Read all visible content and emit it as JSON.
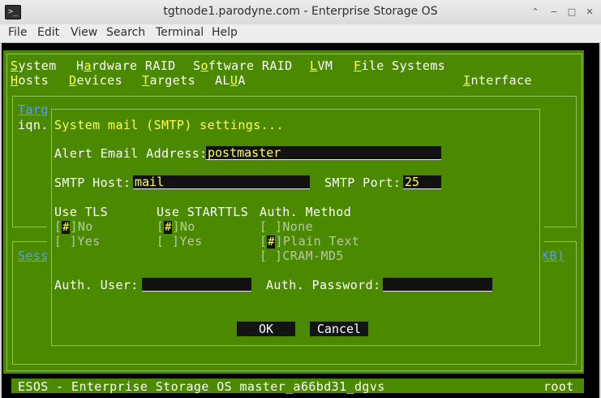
{
  "window": {
    "title": "tgtnode1.parodyne.com - Enterprise Storage OS",
    "controls": [
      "⌃",
      "−",
      "□",
      "✕"
    ]
  },
  "menubar": [
    "File",
    "Edit",
    "View",
    "Search",
    "Terminal",
    "Help"
  ],
  "tui_menu": {
    "row1": [
      {
        "key": "S",
        "rest": "ystem"
      },
      {
        "pre": "H",
        "key": "a",
        "rest": "rdware RAID"
      },
      {
        "pre": "S",
        "key": "o",
        "rest": "ftware RAID"
      },
      {
        "key": "L",
        "rest": "VM"
      },
      {
        "key": "F",
        "rest": "ile Systems"
      }
    ],
    "row2": [
      {
        "key": "H",
        "rest": "osts"
      },
      {
        "key": "D",
        "rest": "evices"
      },
      {
        "key": "T",
        "rest": "argets"
      },
      {
        "pre": "AL",
        "key": "U",
        "rest": "A"
      },
      {
        "key": "I",
        "rest": "nterface"
      }
    ]
  },
  "background": {
    "targets_label": "Targ",
    "iqn_label": "iqn.",
    "sessions_label": "Sess",
    "kb_label": "KB)"
  },
  "dialog": {
    "title": "System mail (SMTP) settings...",
    "alert_email_label": "Alert Email Address:",
    "alert_email_value": "postmaster",
    "smtp_host_label": "SMTP Host:",
    "smtp_host_value": "mail",
    "smtp_port_label": "SMTP Port:",
    "smtp_port_value": "25",
    "use_tls": {
      "label": "Use TLS",
      "options": [
        {
          "mark": "#",
          "text": "No"
        },
        {
          "mark": " ",
          "text": "Yes"
        }
      ]
    },
    "use_starttls": {
      "label": "Use STARTTLS",
      "options": [
        {
          "mark": "#",
          "text": "No"
        },
        {
          "mark": " ",
          "text": "Yes"
        }
      ]
    },
    "auth_method": {
      "label": "Auth. Method",
      "options": [
        {
          "mark": " ",
          "text": "None"
        },
        {
          "mark": "#",
          "text": "Plain Text"
        },
        {
          "mark": " ",
          "text": "CRAM-MD5"
        }
      ]
    },
    "auth_user_label": "Auth. User:",
    "auth_user_value": "",
    "auth_password_label": "Auth. Password:",
    "auth_password_value": "",
    "ok_label": "OK",
    "cancel_label": "Cancel"
  },
  "statusbar": {
    "left": "ESOS - Enterprise Storage OS master_a66bd31_dgvs",
    "right": "root"
  }
}
